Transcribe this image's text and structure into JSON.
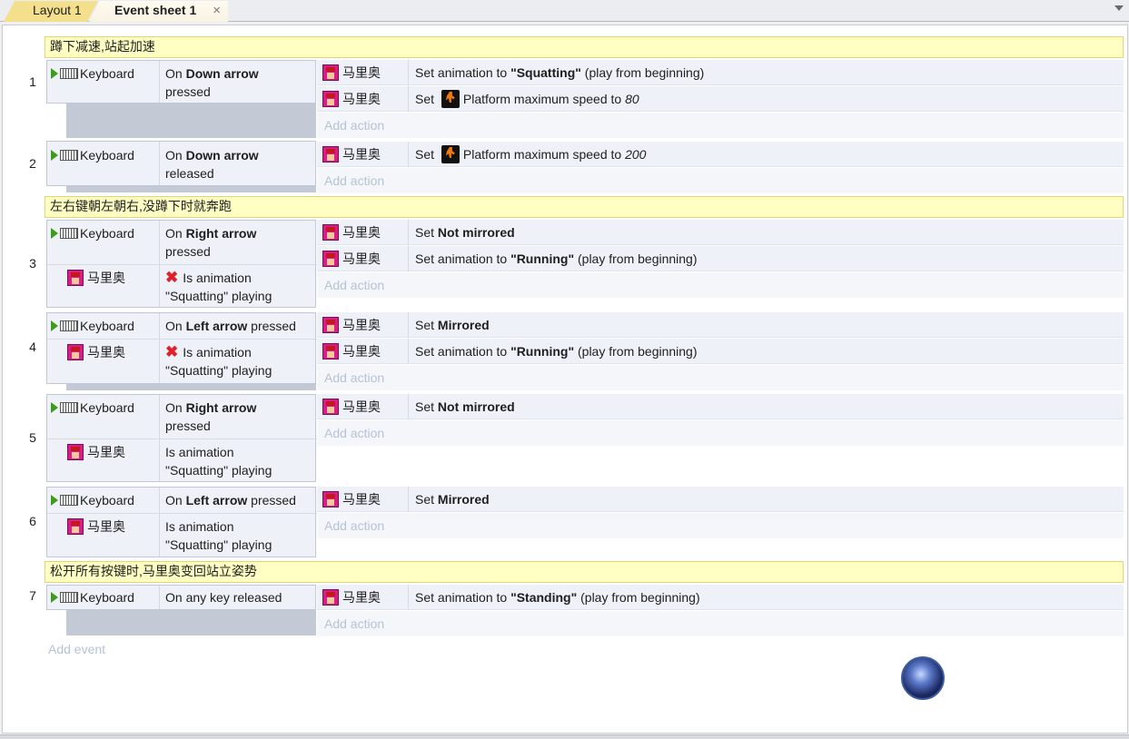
{
  "tabs": [
    {
      "label": "Layout 1"
    },
    {
      "label": "Event sheet 1",
      "close": "×"
    }
  ],
  "comments": [
    "蹲下减速,站起加速",
    "左右键朝左朝右,没蹲下时就奔跑",
    "松开所有按键时,马里奥变回站立姿势"
  ],
  "objects": {
    "keyboard": "Keyboard",
    "mario": "马里奥"
  },
  "events": [
    {
      "number": "1",
      "conditions": [
        {
          "object": "Keyboard",
          "pre": "On ",
          "bold": "Down arrow",
          "post": "pressed"
        }
      ],
      "actions": [
        {
          "object": "马里奥",
          "pre": "Set animation to ",
          "bold": "\"Squatting\"",
          "post": " (play from beginning)"
        },
        {
          "object": "马里奥",
          "pre": "Set ",
          "behavior": "Platform maximum speed to ",
          "ital": "80"
        }
      ]
    },
    {
      "number": "2",
      "conditions": [
        {
          "object": "Keyboard",
          "pre": "On ",
          "bold": "Down arrow",
          "post": "released"
        }
      ],
      "actions": [
        {
          "object": "马里奥",
          "pre": "Set ",
          "behavior": "Platform maximum speed to ",
          "ital": "200"
        }
      ]
    },
    {
      "number": "3",
      "conditions": [
        {
          "object": "Keyboard",
          "pre": "On ",
          "bold": "Right arrow",
          "post": "pressed"
        },
        {
          "object": "马里奥",
          "inverted": true,
          "line1": "Is animation",
          "line2": "\"Squatting\" playing"
        }
      ],
      "actions": [
        {
          "object": "马里奥",
          "pre": "Set ",
          "bold": "Not mirrored",
          "post": ""
        },
        {
          "object": "马里奥",
          "pre": "Set animation to ",
          "bold": "\"Running\"",
          "post": " (play from beginning)"
        }
      ]
    },
    {
      "number": "4",
      "conditions": [
        {
          "object": "Keyboard",
          "pre": "On ",
          "bold": "Left arrow",
          "post": " pressed"
        },
        {
          "object": "马里奥",
          "inverted": true,
          "line1": "Is animation",
          "line2": "\"Squatting\" playing"
        }
      ],
      "actions": [
        {
          "object": "马里奥",
          "pre": "Set ",
          "bold": "Mirrored",
          "post": ""
        },
        {
          "object": "马里奥",
          "pre": "Set animation to ",
          "bold": "\"Running\"",
          "post": " (play from beginning)"
        }
      ]
    },
    {
      "number": "5",
      "conditions": [
        {
          "object": "Keyboard",
          "pre": "On ",
          "bold": "Right arrow",
          "post": "pressed"
        },
        {
          "object": "马里奥",
          "line1": "Is animation",
          "line2": "\"Squatting\" playing"
        }
      ],
      "actions": [
        {
          "object": "马里奥",
          "pre": "Set ",
          "bold": "Not mirrored",
          "post": ""
        }
      ]
    },
    {
      "number": "6",
      "conditions": [
        {
          "object": "Keyboard",
          "pre": "On ",
          "bold": "Left arrow",
          "post": " pressed"
        },
        {
          "object": "马里奥",
          "line1": "Is animation",
          "line2": "\"Squatting\" playing"
        }
      ],
      "actions": [
        {
          "object": "马里奥",
          "pre": "Set ",
          "bold": "Mirrored",
          "post": ""
        }
      ]
    },
    {
      "number": "7",
      "conditions": [
        {
          "object": "Keyboard",
          "text": "On any key released"
        }
      ],
      "actions": [
        {
          "object": "马里奥",
          "pre": "Set animation to ",
          "bold": "\"Standing\"",
          "post": " (play from beginning)"
        }
      ]
    }
  ],
  "add_action": "Add action",
  "add_event": "Add event"
}
